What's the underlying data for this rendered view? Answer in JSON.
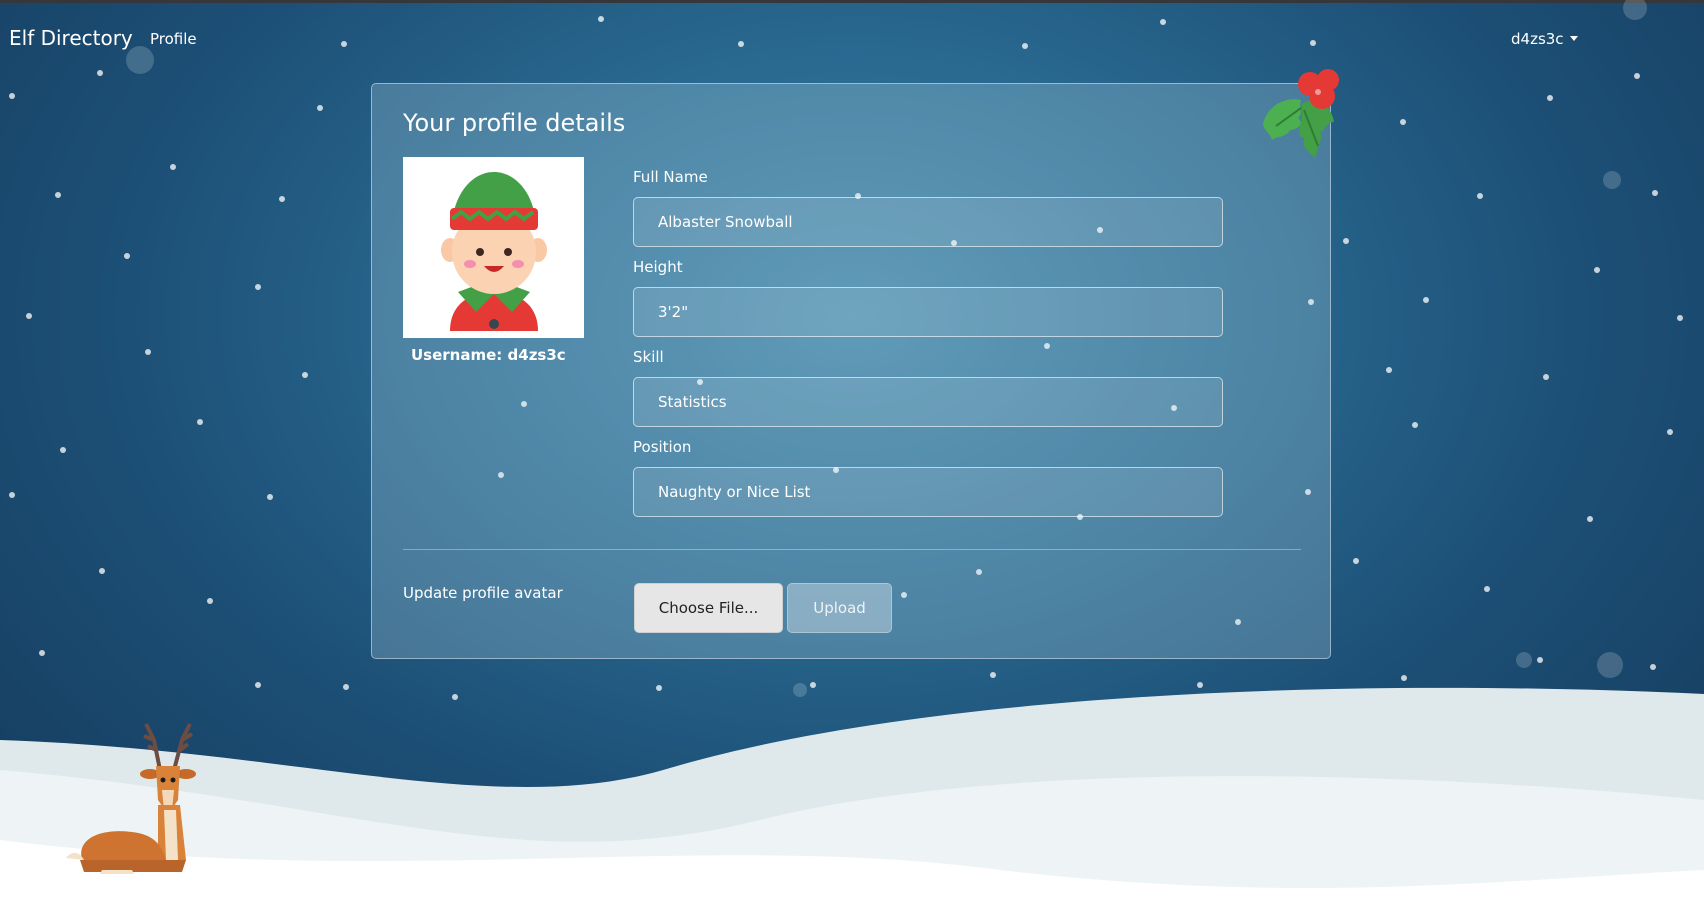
{
  "navbar": {
    "brand": "Elf Directory",
    "profile_link": "Profile",
    "user_menu": "d4zs3c"
  },
  "card": {
    "title": "Your profile details",
    "username_prefix": "Username:",
    "username": "d4zs3c",
    "fields": [
      {
        "label": "Full Name",
        "value": "Albaster Snowball"
      },
      {
        "label": "Height",
        "value": "3'2\""
      },
      {
        "label": "Skill",
        "value": "Statistics"
      },
      {
        "label": "Position",
        "value": "Naughty or Nice List"
      }
    ],
    "upload": {
      "label": "Update profile avatar",
      "choose_button": "Choose File...",
      "upload_button": "Upload"
    }
  },
  "icons": {
    "avatar": "elf-avatar-icon",
    "holly": "holly-icon",
    "reindeer": "reindeer-icon",
    "caret": "caret-down-icon"
  },
  "colors": {
    "background": "#1d5077",
    "card": "rgba(215,240,250,0.22)",
    "text": "#ffffff"
  }
}
